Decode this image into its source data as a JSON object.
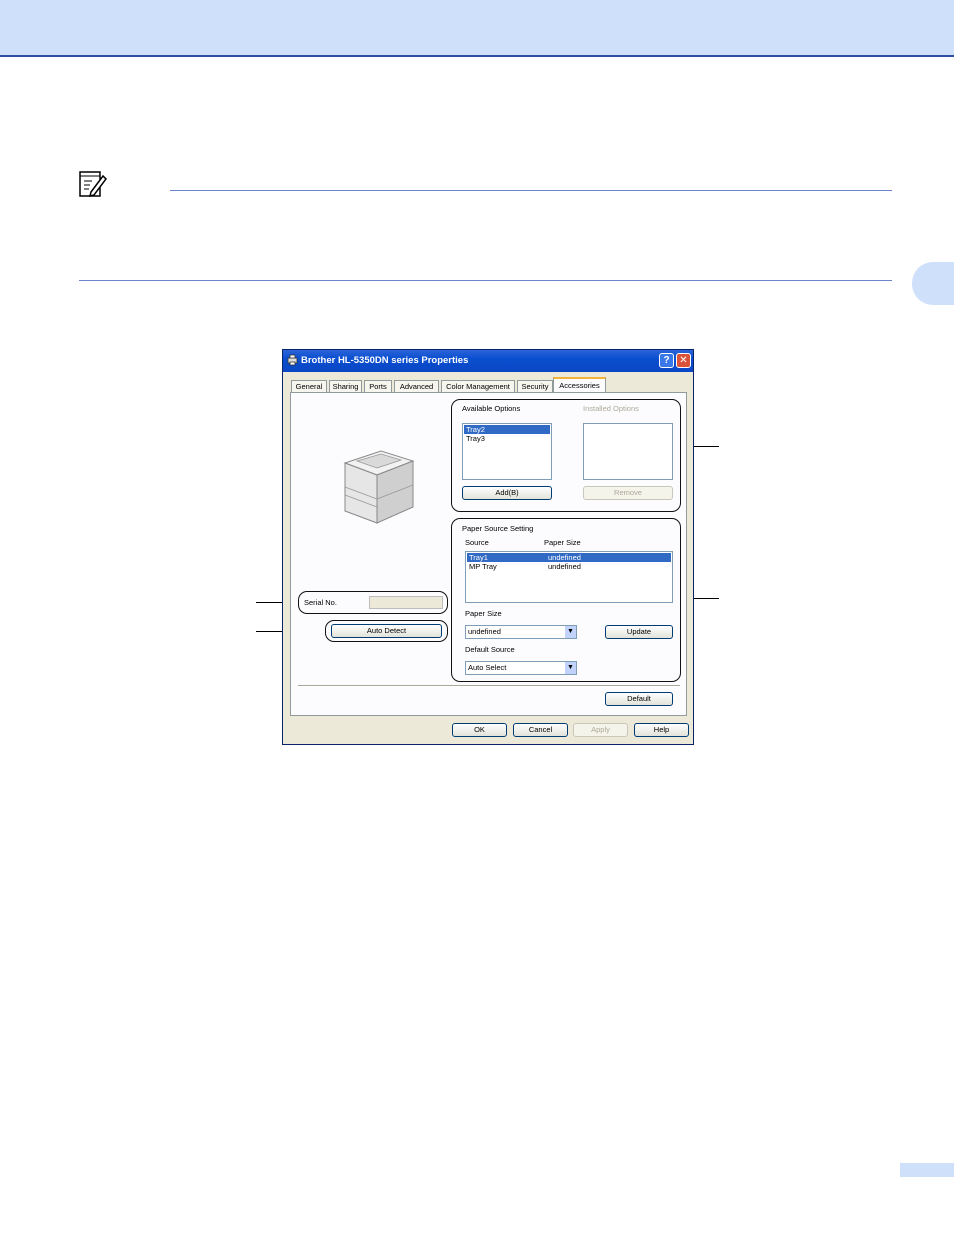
{
  "dialog": {
    "title": "Brother HL-5350DN series Properties",
    "help_symbol": "?",
    "close_symbol": "✕",
    "tabs": [
      {
        "label": "General"
      },
      {
        "label": "Sharing"
      },
      {
        "label": "Ports"
      },
      {
        "label": "Advanced"
      },
      {
        "label": "Color Management"
      },
      {
        "label": "Security"
      },
      {
        "label": "Accessories"
      }
    ],
    "active_tab": "Accessories",
    "available_options": {
      "label": "Available Options",
      "items": [
        "Tray2",
        "Tray3"
      ],
      "selected": "Tray2",
      "add_button": "Add(B)"
    },
    "installed_options": {
      "label": "Installed Options",
      "items": [],
      "remove_button": "Remove"
    },
    "paper_source_setting": {
      "label": "Paper Source Setting",
      "col_source": "Source",
      "col_paper_size": "Paper Size",
      "rows": [
        {
          "source": "Tray1",
          "size": "undefined"
        },
        {
          "source": "MP Tray",
          "size": "undefined"
        }
      ],
      "selected": "Tray1",
      "paper_size_label": "Paper Size",
      "paper_size_value": "undefined",
      "update_button": "Update",
      "default_source_label": "Default Source",
      "default_source_value": "Auto Select"
    },
    "serial_no_label": "Serial No.",
    "serial_no_value": "",
    "auto_detect_button": "Auto Detect",
    "default_button": "Default",
    "footer": {
      "ok": "OK",
      "cancel": "Cancel",
      "apply": "Apply",
      "help": "Help"
    }
  },
  "colors": {
    "band": "#cfe0fb",
    "rule": "#6a86cf",
    "title_bar": "#0a4fd0",
    "selection": "#316ac5"
  },
  "icons": {
    "note": "note-pencil-icon",
    "printer": "printer-icon"
  }
}
